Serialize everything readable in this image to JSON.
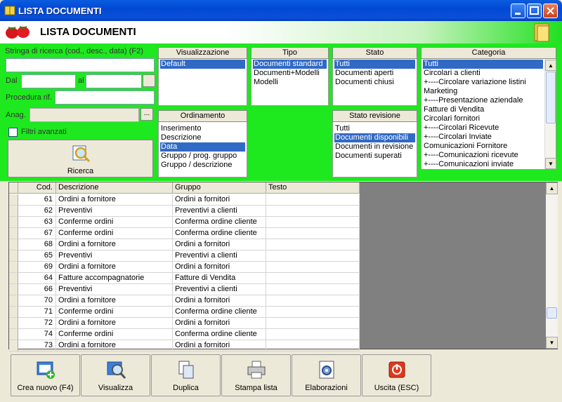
{
  "window": {
    "title": "LISTA DOCUMENTI"
  },
  "header": {
    "title": "LISTA DOCUMENTI"
  },
  "filters": {
    "search_label": "Stringa di ricerca (cod., desc., data) (F2)",
    "search_value": "",
    "dal_label": "Dal",
    "al_label": "al",
    "procedura_label": "Procedura rif.",
    "anag_label": "Anag.",
    "ellipsis": "...",
    "filtri_label": "Filtri avanzati",
    "ricerca_label": "Ricerca"
  },
  "visualizzazione": {
    "title": "Visualizzazione",
    "items": [
      "Default"
    ],
    "selected": 0
  },
  "tipo": {
    "title": "Tipo",
    "items": [
      "Documenti standard",
      "Documenti+Modelli",
      "Modelli"
    ],
    "selected": 0
  },
  "stato": {
    "title": "Stato",
    "items": [
      "Tutti",
      "Documenti aperti",
      "Documenti chiusi"
    ],
    "selected": 0
  },
  "categoria": {
    "title": "Categoria",
    "items": [
      "Tutti",
      "Circolari a clienti",
      "+----Circolare variazione listini",
      "Marketing",
      "+----Presentazione aziendale",
      "Fatture di Vendita",
      "Circolari fornitori",
      "+----Circolari Ricevute",
      "+----Circolari Inviate",
      "Comunicazioni Fornitore",
      "+----Comunicazioni ricevute",
      "+----Comunicazioni inviate"
    ],
    "selected": 0
  },
  "ordinamento": {
    "title": "Ordinamento",
    "items": [
      "Inserimento",
      "Descrizione",
      "Data",
      "Gruppo / prog. gruppo",
      "Gruppo / descrizione"
    ],
    "selected": 2
  },
  "stato_revisione": {
    "title": "Stato revisione",
    "items": [
      "Tutti",
      "Documenti disponibili",
      "Documenti in revisione",
      "Documenti superati"
    ],
    "selected": 1
  },
  "table": {
    "columns": [
      "Cod.",
      "Descrizione",
      "Gruppo",
      "Testo"
    ],
    "rows": [
      [
        "61",
        "Ordini a fornitore",
        "Ordini a fornitori",
        ""
      ],
      [
        "62",
        "Preventivi",
        "Preventivi a clienti",
        ""
      ],
      [
        "63",
        "Conferme ordini",
        "Conferma ordine cliente",
        ""
      ],
      [
        "67",
        "Conferme ordini",
        "Conferma ordine cliente",
        ""
      ],
      [
        "68",
        "Ordini a fornitore",
        "Ordini a fornitori",
        ""
      ],
      [
        "65",
        "Preventivi",
        "Preventivi a clienti",
        ""
      ],
      [
        "69",
        "Ordini a fornitore",
        "Ordini a fornitori",
        ""
      ],
      [
        "64",
        "Fatture accompagnatorie",
        "Fatture di Vendita",
        ""
      ],
      [
        "66",
        "Preventivi",
        "Preventivi a clienti",
        ""
      ],
      [
        "70",
        "Ordini a fornitore",
        "Ordini a fornitori",
        ""
      ],
      [
        "71",
        "Conferme ordini",
        "Conferma ordine cliente",
        ""
      ],
      [
        "72",
        "Ordini a fornitore",
        "Ordini a fornitori",
        ""
      ],
      [
        "74",
        "Conferme ordini",
        "Conferma ordine cliente",
        ""
      ],
      [
        "73",
        "Ordini a fornitore",
        "Ordini a fornitori",
        ""
      ]
    ]
  },
  "toolbar": {
    "crea": "Crea nuovo (F4)",
    "visualizza": "Visualizza",
    "duplica": "Duplica",
    "stampa": "Stampa lista",
    "elaborazioni": "Elaborazioni",
    "uscita": "Uscita (ESC)"
  },
  "colors": {
    "panel_green": "#1ee81e",
    "selection": "#316ac5",
    "titlebar": "#0149d4"
  }
}
